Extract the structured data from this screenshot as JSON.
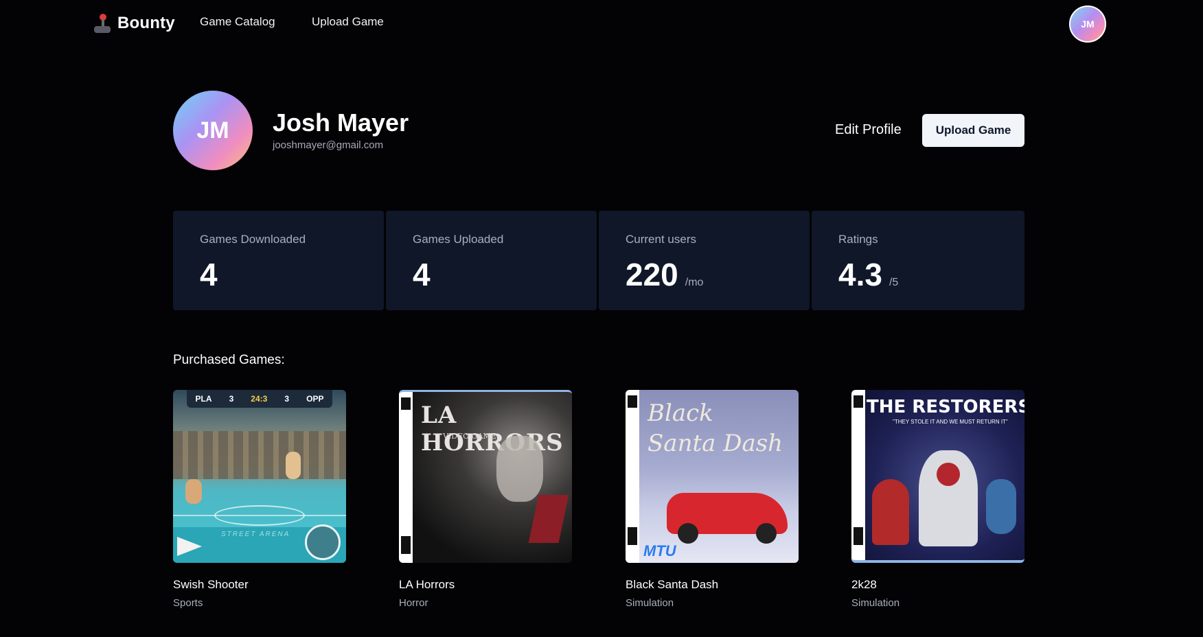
{
  "nav": {
    "brand_name": "Bounty",
    "links": [
      "Game Catalog",
      "Upload Game"
    ],
    "avatar_initials": "JM"
  },
  "profile": {
    "initials": "JM",
    "name": "Josh Mayer",
    "email": "jooshmayer@gmail.com",
    "edit_label": "Edit Profile",
    "upload_label": "Upload Game"
  },
  "stats": [
    {
      "label": "Games Downloaded",
      "value": "4",
      "unit": ""
    },
    {
      "label": "Games Uploaded",
      "value": "4",
      "unit": ""
    },
    {
      "label": "Current users",
      "value": "220",
      "unit": "/mo"
    },
    {
      "label": "Ratings",
      "value": "4.3",
      "unit": "/5"
    }
  ],
  "purchased": {
    "title": "Purchased Games:",
    "games": [
      {
        "title": "Swish Shooter",
        "genre": "Sports",
        "cover_text": "",
        "scoreboard": [
          "PLA",
          "3",
          "24:3",
          "3",
          "OPP"
        ],
        "court_text": "STREET ARENA"
      },
      {
        "title": "LA Horrors",
        "genre": "Horror",
        "cover_text": "LA HORRORS",
        "cover_subtext": "VIDEO GAME"
      },
      {
        "title": "Black Santa Dash",
        "genre": "Simulation",
        "cover_text": "Black Santa Dash",
        "cover_subtext": "MTU"
      },
      {
        "title": "2k28",
        "genre": "Simulation",
        "cover_text": "THE RESTORERS",
        "cover_subtext": "\"THEY STOLE IT AND WE MUST RETURN IT\""
      }
    ]
  },
  "colors": {
    "background": "#030305",
    "stat_card": "#101728",
    "muted_text": "#a9afbd",
    "button_bg": "#f1f5f9",
    "button_text": "#0f172a"
  }
}
